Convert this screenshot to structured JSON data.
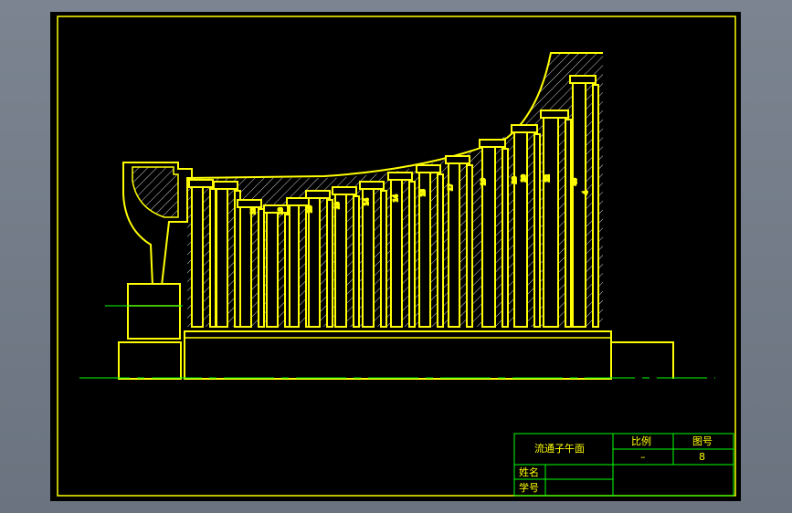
{
  "title_block": {
    "drawing_title": "流通子午面",
    "scale_label": "比例",
    "scale_value": "–",
    "drawing_no_label": "图号",
    "drawing_no_value": "8",
    "name_label": "姓名",
    "student_no_label": "学号"
  },
  "colors": {
    "background": "#000000",
    "outline": "#ffff00",
    "centerline": "#00ff00",
    "hatch": "#d8d8d8",
    "frame": "#ffff00"
  },
  "blade_labels": [
    "13",
    "13",
    "13",
    "13",
    "14",
    "14",
    "15",
    "17",
    "19",
    "20",
    "20",
    "22",
    "40",
    "4"
  ]
}
